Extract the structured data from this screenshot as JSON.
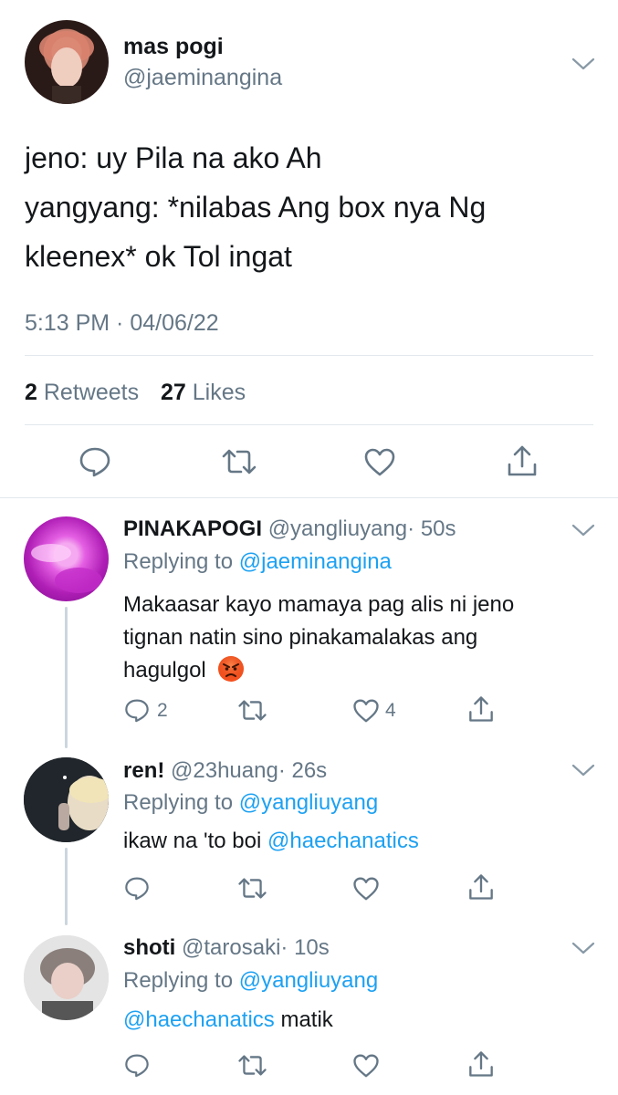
{
  "colors": {
    "accent": "#1da1f2",
    "text": "#14171a",
    "muted": "#657786",
    "divider": "#e1e8ed"
  },
  "main_tweet": {
    "display_name": "mas pogi",
    "handle": "@jaeminangina",
    "lines": [
      "jeno: uy Pila na ako Ah",
      "yangyang: *nilabas Ang box nya Ng",
      "kleenex* ok Tol ingat"
    ],
    "timestamp": "5:13 PM · 04/06/22",
    "retweets_count": "2",
    "retweets_label": "Retweets",
    "likes_count": "27",
    "likes_label": "Likes",
    "icons": [
      "reply-icon",
      "retweet-icon",
      "like-icon",
      "share-icon"
    ]
  },
  "replies": [
    {
      "display_name": "PINAKAPOGI",
      "handle": "@yangliuyang",
      "time": "· 50s",
      "replying_label": "Replying to",
      "replying_to": "@jaeminangina",
      "lines": [
        "Makaasar kayo mamaya pag alis ni jeno",
        "tignan natin sino pinakamalakas ang",
        "hagulgol"
      ],
      "emoji": "angry-face",
      "reply_count": "2",
      "like_count": "4"
    },
    {
      "display_name": "ren!",
      "handle": "@23huang",
      "time": "· 26s",
      "replying_label": "Replying to",
      "replying_to": "@yangliuyang",
      "text": "ikaw na 'to boi",
      "mention": "@haechanatics"
    },
    {
      "display_name": "shoti",
      "handle": "@tarosaki",
      "time": "· 10s",
      "replying_label": "Replying to",
      "replying_to": "@yangliuyang",
      "mention": "@haechanatics",
      "text": "matik"
    }
  ]
}
